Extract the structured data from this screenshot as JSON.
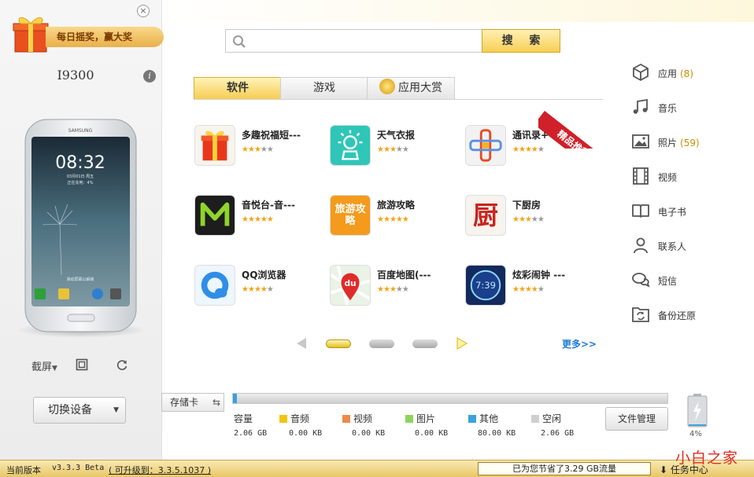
{
  "promo": {
    "text": "每日摇奖，赢大奖",
    "close": "×"
  },
  "device": {
    "name": "I9300",
    "info": "i",
    "phone_brand": "SAMSUNG",
    "phone_time": "08:32",
    "phone_date": "03月01日 周五",
    "phone_status": "正在充电：4%",
    "unlock": "滑动屏幕以解锁"
  },
  "left_tools": {
    "screenshot": "截屏",
    "switch_device": "切换设备"
  },
  "search": {
    "placeholder": "",
    "button": "搜 索"
  },
  "tabs": [
    {
      "label": "软件"
    },
    {
      "label": "游戏"
    },
    {
      "label": "应用大赏"
    }
  ],
  "ribbon": "精品推荐",
  "apps": [
    {
      "name": "多趣祝福短---",
      "rating": 3,
      "icon_bg": "#f5f5f5",
      "icon_fg": "#e8361c"
    },
    {
      "name": "天气衣报",
      "rating": 3,
      "icon_bg": "#2fc6b8",
      "icon_fg": "#ffffff"
    },
    {
      "name": "通讯录+",
      "rating": 4,
      "icon_bg": "#f2f2f2",
      "icon_fg": "#e94a22"
    },
    {
      "name": "音悦台-音---",
      "rating": 5,
      "icon_bg": "#1d1d1d",
      "icon_fg": "#8fd42b"
    },
    {
      "name": "旅游攻略",
      "rating": 5,
      "icon_bg": "#f49a1c",
      "icon_fg": "#ffffff",
      "icon_text": "旅游攻略"
    },
    {
      "name": "下厨房",
      "rating": 3,
      "icon_bg": "#f7f3ee",
      "icon_fg": "#c8251d",
      "icon_text": "厨"
    },
    {
      "name": "QQ浏览器",
      "rating": 4,
      "icon_bg": "#eef6ff",
      "icon_fg": "#2f8ee8"
    },
    {
      "name": "百度地图(---",
      "rating": 3,
      "icon_bg": "#eaf3e6",
      "icon_fg": "#e02b2b",
      "icon_text": "du"
    },
    {
      "name": "炫彩闹钟 ---",
      "rating": 4,
      "icon_bg": "#132a5e",
      "icon_fg": "#8fd8ff",
      "icon_text": "7:39"
    }
  ],
  "more": "更多>>",
  "nav": [
    {
      "label": "应用",
      "count": "(8)",
      "icon": "cube-icon"
    },
    {
      "label": "音乐",
      "count": "",
      "icon": "music-note-icon"
    },
    {
      "label": "照片",
      "count": "(59)",
      "icon": "image-icon"
    },
    {
      "label": "视频",
      "count": "",
      "icon": "film-icon"
    },
    {
      "label": "电子书",
      "count": "",
      "icon": "book-icon"
    },
    {
      "label": "联系人",
      "count": "",
      "icon": "person-icon"
    },
    {
      "label": "短信",
      "count": "",
      "icon": "chat-bubbles-icon"
    },
    {
      "label": "备份还原",
      "count": "",
      "icon": "backup-folder-icon"
    }
  ],
  "storage": {
    "select": "存储卡",
    "used_fraction": 0.009,
    "capacity_label": "容量",
    "capacity": "2.06 GB",
    "items": [
      {
        "label": "音频",
        "size": "0.00 KB",
        "color": "#f1c40f"
      },
      {
        "label": "视频",
        "size": "0.00 KB",
        "color": "#ee8a4a"
      },
      {
        "label": "图片",
        "size": "0.00 KB",
        "color": "#8cd55b"
      },
      {
        "label": "其他",
        "size": "80.00 KB",
        "color": "#3aa3dc"
      },
      {
        "label": "空闲",
        "size": "2.06 GB",
        "color": "#cfcfcf"
      }
    ],
    "file_manager": "文件管理",
    "battery": "4%",
    "battery_fraction": 0.04
  },
  "status": {
    "version_label": "当前版本",
    "version": "v3.3.3 Beta",
    "upgrade": "( 可升级到：3.3.5.1037 )",
    "saved": "已为您节省了3.29 GB流量",
    "task_center": "任务中心"
  },
  "watermark": "小白之家"
}
